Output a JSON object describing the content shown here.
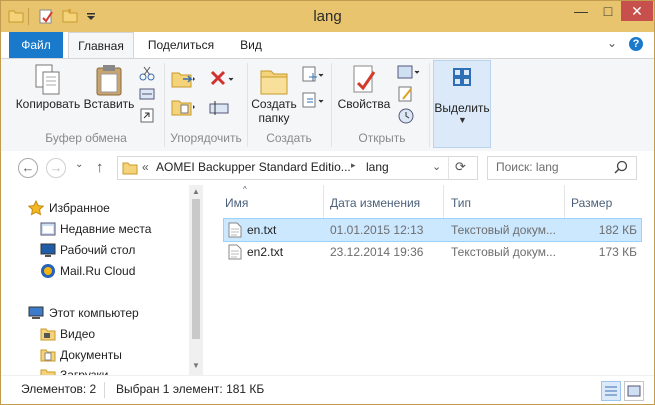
{
  "window": {
    "title": "lang",
    "controls": {
      "minimize": "—",
      "maximize": "□",
      "close": "✕"
    }
  },
  "ribbon": {
    "tabs": [
      "Файл",
      "Главная",
      "Поделиться",
      "Вид"
    ],
    "active_tab": "Главная",
    "help_chevron": "⌄",
    "help_icon": "?",
    "groups": {
      "clipboard": {
        "label": "Буфер обмена",
        "copy": "Копировать",
        "paste": "Вставить"
      },
      "organize": {
        "label": "Упорядочить"
      },
      "new": {
        "label": "Создать",
        "new_folder_line1": "Создать",
        "new_folder_line2": "папку"
      },
      "open": {
        "label": "Открыть",
        "properties": "Свойства"
      },
      "select": {
        "label": "Выделить"
      }
    }
  },
  "nav": {
    "back": "←",
    "forward": "→",
    "up": "↑",
    "breadcrumb_prefix": "«",
    "breadcrumb": [
      "AOMEI Backupper Standard Editio...",
      "lang"
    ],
    "crumb_arrow": "▸",
    "dropdown": "⌄",
    "refresh": "⟳",
    "search_placeholder": "Поиск: lang"
  },
  "sidebar": {
    "favorites_header": "Избранное",
    "favorites": [
      "Недавние места",
      "Рабочий стол",
      "Mail.Ru Cloud"
    ],
    "computer_header": "Этот компьютер",
    "computer_items": [
      "Видео",
      "Документы",
      "Загрузки"
    ]
  },
  "columns": {
    "name": "Имя",
    "date": "Дата изменения",
    "type": "Тип",
    "size": "Размер"
  },
  "files": [
    {
      "name": "en.txt",
      "date": "01.01.2015 12:13",
      "type": "Текстовый докум...",
      "size": "182 КБ",
      "selected": true
    },
    {
      "name": "en2.txt",
      "date": "23.12.2014 19:36",
      "type": "Текстовый докум...",
      "size": "173 КБ",
      "selected": false
    }
  ],
  "status": {
    "count": "Элементов: 2",
    "selection": "Выбран 1 элемент: 181 КБ"
  },
  "colors": {
    "title_bar": "#e9c46f",
    "file_tab": "#1979ca",
    "selection": "#cce8ff",
    "close_button": "#c7504c"
  },
  "icons": {
    "quick_access": [
      "folder-icon",
      "properties-icon",
      "new-folder-icon",
      "dropdown-arrow-icon"
    ],
    "clipboard": [
      "copy-icon",
      "paste-icon",
      "cut-icon",
      "copy-path-icon",
      "paste-shortcut-icon"
    ],
    "organize": [
      "move-to-icon",
      "copy-to-icon",
      "delete-icon",
      "rename-icon"
    ],
    "new": [
      "new-folder-icon",
      "new-item-icon",
      "easy-access-icon"
    ],
    "open": [
      "properties-icon",
      "open-icon",
      "edit-icon",
      "history-icon"
    ],
    "select": "select-all-icon"
  }
}
